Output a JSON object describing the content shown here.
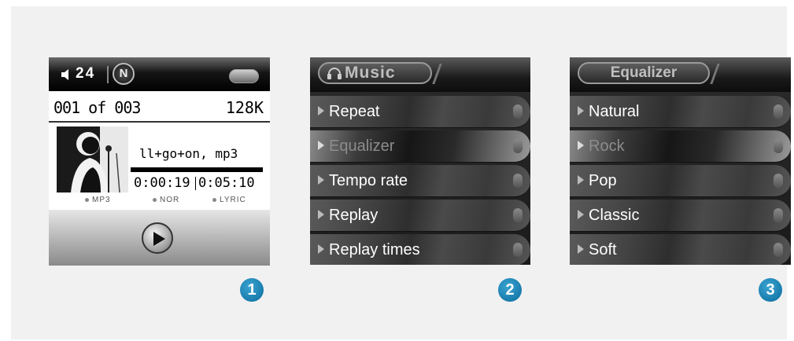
{
  "player": {
    "volume": "24",
    "mode_badge": "N",
    "track_count": "001 of 003",
    "bitrate": "128K",
    "filename": "ll+go+on, mp3",
    "elapsed": "0:00:19",
    "total": "0:05:10",
    "tags": [
      "MP3",
      "NOR",
      "LYRIC"
    ]
  },
  "music_menu": {
    "title": "Music",
    "items": [
      "Repeat",
      "Equalizer",
      "Tempo rate",
      "Replay",
      "Replay times"
    ],
    "selected": "Equalizer"
  },
  "equalizer_menu": {
    "title": "Equalizer",
    "items": [
      "Natural",
      "Rock",
      "Pop",
      "Classic",
      "Soft"
    ],
    "selected": "Rock"
  },
  "steps": [
    "1",
    "2",
    "3"
  ],
  "colors": {
    "step_badge": "#1a86b8",
    "menu_bg": "#262626"
  }
}
